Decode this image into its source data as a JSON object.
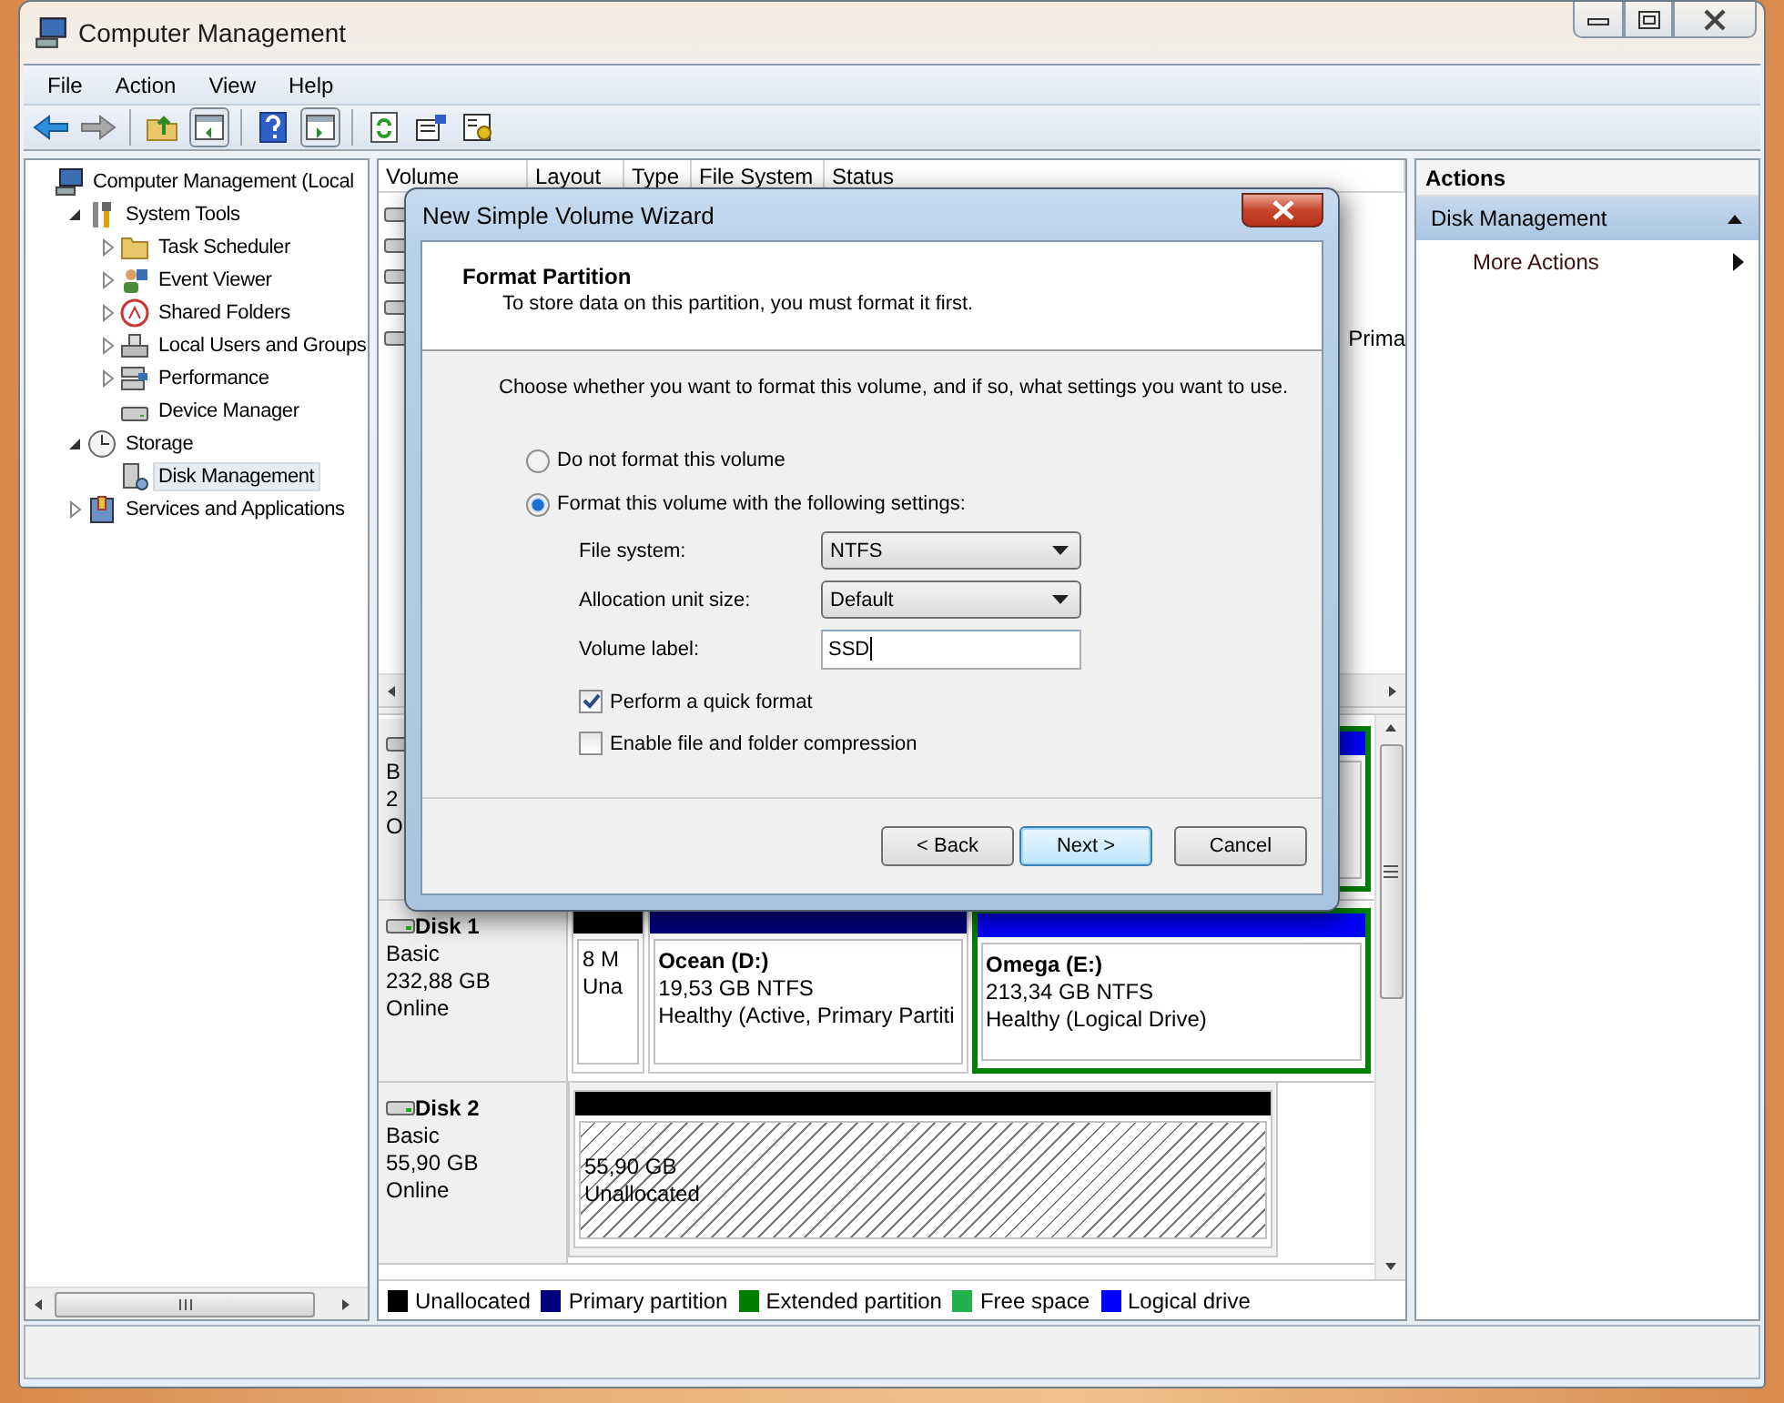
{
  "window": {
    "title": "Computer Management"
  },
  "menu": [
    "File",
    "Action",
    "View",
    "Help"
  ],
  "tree": [
    {
      "label": "Computer Management (Local",
      "selected": false,
      "children": [
        {
          "label": "System Tools",
          "selected": false,
          "expanded": true,
          "children": [
            {
              "label": "Task Scheduler",
              "selected": false,
              "expanded": false
            },
            {
              "label": "Event Viewer",
              "selected": false,
              "expanded": false
            },
            {
              "label": "Shared Folders",
              "selected": false,
              "expanded": false
            },
            {
              "label": "Local Users and Groups",
              "selected": false,
              "expanded": false
            },
            {
              "label": "Performance",
              "selected": false,
              "expanded": false
            },
            {
              "label": "Device Manager",
              "selected": false
            }
          ]
        },
        {
          "label": "Storage",
          "selected": false,
          "expanded": true,
          "children": [
            {
              "label": "Disk Management",
              "selected": true
            }
          ]
        },
        {
          "label": "Services and Applications",
          "selected": false,
          "expanded": false
        }
      ]
    }
  ],
  "volume_list": {
    "columns": [
      "Volume",
      "Layout",
      "Type",
      "File System",
      "Status"
    ],
    "rows": [
      {
        "kind": "covered"
      },
      {
        "kind": "covered"
      },
      {
        "kind": "covered"
      },
      {
        "kind": "covered"
      },
      {
        "kind": "partial",
        "status": "Prima"
      }
    ]
  },
  "disks": [
    {
      "info": [
        "B",
        "2",
        "O"
      ],
      "partitions": [
        {
          "color": "#0000ff",
          "in_extended": true
        }
      ]
    },
    {
      "name": "Disk 1",
      "info": [
        "Basic",
        "232,88 GB",
        "Online"
      ],
      "partitions": [
        {
          "color": "#000000",
          "in_extended": false,
          "lines": [
            "8 M",
            "Una"
          ]
        },
        {
          "color": "#000080",
          "in_extended": false,
          "name": "Ocean  (D:)",
          "lines": [
            "19,53 GB NTFS",
            "Healthy (Active, Primary Partiti"
          ]
        },
        {
          "color": "#0000ff",
          "in_extended": true,
          "name": "Omega  (E:)",
          "lines": [
            "213,34 GB NTFS",
            "Healthy (Logical Drive)"
          ]
        }
      ]
    },
    {
      "name": "Disk 2",
      "info": [
        "Basic",
        "55,90 GB",
        "Online"
      ],
      "partitions": [
        {
          "color": "#000000",
          "in_extended": false,
          "hatched": true,
          "lines": [
            "55,90 GB",
            "Unallocated"
          ]
        }
      ]
    }
  ],
  "legend": [
    {
      "label": "Unallocated",
      "color": "#000000"
    },
    {
      "label": "Primary partition",
      "color": "#000080"
    },
    {
      "label": "Extended partition",
      "color": "#008000"
    },
    {
      "label": "Free space",
      "color": "#22b14c"
    },
    {
      "label": "Logical drive",
      "color": "#0000ff"
    }
  ],
  "actions": {
    "title": "Actions",
    "sections": [
      {
        "label": "Disk Management",
        "expanded": true,
        "items": [
          "More Actions"
        ]
      }
    ]
  },
  "dialog": {
    "title": "New Simple Volume Wizard",
    "heading": "Format Partition",
    "subheading": "To store data on this partition, you must format it first.",
    "instruction": "Choose whether you want to format this volume, and if so, what settings you want to use.",
    "options": [
      {
        "label": "Do not format this volume",
        "selected": false
      },
      {
        "label": "Format this volume with the following settings:",
        "selected": true
      }
    ],
    "fields": [
      {
        "kind": "select",
        "label": "File system:",
        "value": "NTFS"
      },
      {
        "kind": "select",
        "label": "Allocation unit size:",
        "value": "Default"
      },
      {
        "kind": "text",
        "label": "Volume label:",
        "value": "SSD"
      }
    ],
    "checkboxes": [
      {
        "label": "Perform a quick format",
        "checked": true
      },
      {
        "label": "Enable file and folder compression",
        "checked": false
      }
    ],
    "buttons": [
      {
        "label": "< Back",
        "default": false
      },
      {
        "label": "Next >",
        "default": true
      },
      {
        "label": "Cancel",
        "default": false
      }
    ]
  }
}
